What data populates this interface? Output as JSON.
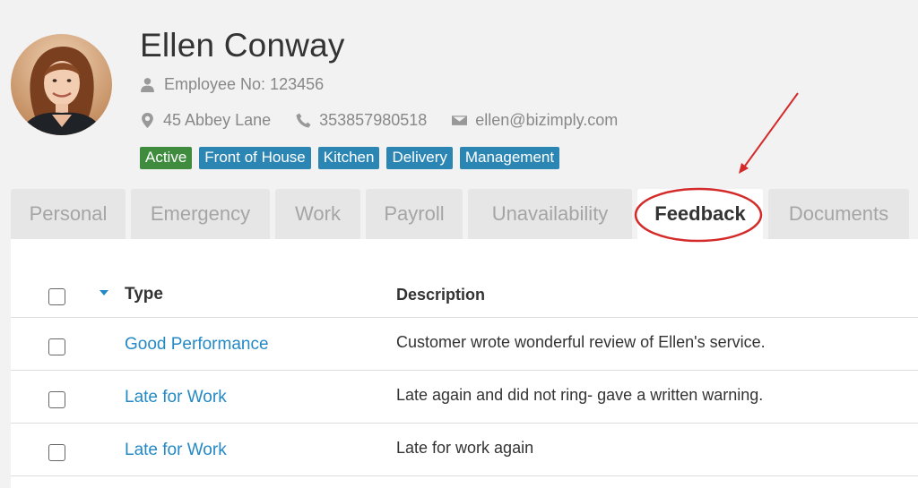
{
  "employee": {
    "name": "Ellen Conway",
    "employee_no": "Employee No: 123456",
    "address": "45 Abbey Lane",
    "phone": "353857980518",
    "email": "ellen@bizimply.com"
  },
  "badges": [
    {
      "label": "Active",
      "color": "#3f8c3f"
    },
    {
      "label": "Front of House",
      "color": "#2c86b4"
    },
    {
      "label": "Kitchen",
      "color": "#2c86b4"
    },
    {
      "label": "Delivery",
      "color": "#2c86b4"
    },
    {
      "label": "Management",
      "color": "#2c86b4"
    }
  ],
  "tabs": [
    {
      "label": "Personal"
    },
    {
      "label": "Emergency"
    },
    {
      "label": "Work"
    },
    {
      "label": "Payroll"
    },
    {
      "label": "Unavailability"
    },
    {
      "label": "Feedback"
    },
    {
      "label": "Documents"
    }
  ],
  "active_tab": "Feedback",
  "table": {
    "columns": [
      "Type",
      "Description"
    ],
    "rows": [
      {
        "type": "Good Performance",
        "description": "Customer wrote wonderful review of Ellen's service."
      },
      {
        "type": "Late for Work",
        "description": "Late again and did not ring- gave a written warning."
      },
      {
        "type": "Late for Work",
        "description": "Late for work again"
      }
    ]
  },
  "icons": {
    "employee": "user-icon",
    "address": "map-marker-icon",
    "phone": "phone-icon",
    "email": "envelope-icon"
  },
  "colors": {
    "link": "#2489c5",
    "annotation": "#d42a2a"
  }
}
